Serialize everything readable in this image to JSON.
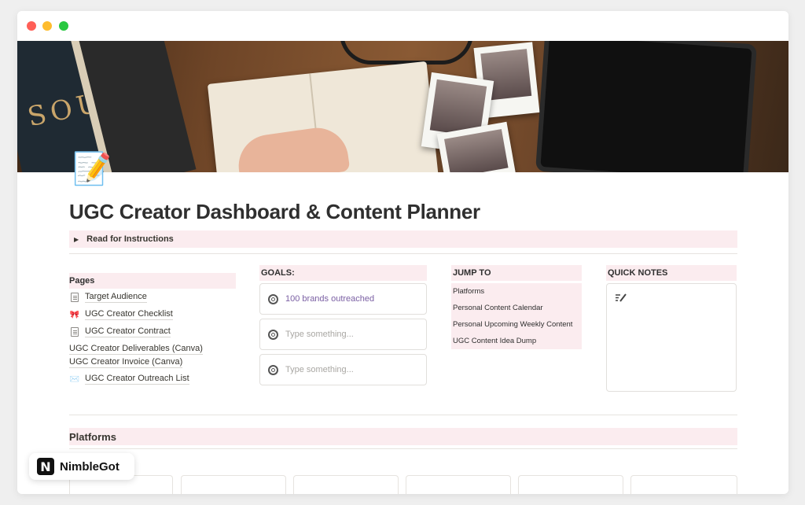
{
  "page": {
    "title": "UGC Creator Dashboard & Content Planner",
    "icon": "📝",
    "instructions_toggle": "Read for Instructions"
  },
  "pages_section": {
    "heading": "Pages",
    "items": [
      {
        "label": "Target Audience",
        "icon": "document-icon"
      },
      {
        "label": "UGC Creator Checklist",
        "icon": "ribbon-icon",
        "glyph": "🎀"
      },
      {
        "label": "UGC Creator Contract",
        "icon": "document-icon"
      },
      {
        "label": "UGC Creator Deliverables (Canva)",
        "icon": ""
      },
      {
        "label": "UGC Creator Invoice (Canva)",
        "icon": ""
      },
      {
        "label": "UGC Creator Outreach List",
        "icon": "envelope-icon",
        "glyph": "✉️"
      }
    ]
  },
  "goals": {
    "heading": "GOALS:",
    "items": [
      {
        "text": "100 brands outreached",
        "placeholder": false
      },
      {
        "text": "Type something...",
        "placeholder": true
      },
      {
        "text": "Type something...",
        "placeholder": true
      }
    ]
  },
  "jump_to": {
    "heading": "JUMP TO",
    "items": [
      "Platforms",
      "Personal Content Calendar",
      "Personal Upcoming Weekly Content",
      "UGC Content Idea Dump"
    ]
  },
  "quick_notes": {
    "heading": "QUICK NOTES",
    "icon": "pen-lines-icon"
  },
  "platforms": {
    "heading": "Platforms"
  },
  "brand": {
    "logo_letter": "N",
    "name": "NimbleGot"
  },
  "colors": {
    "highlight": "#fbecef",
    "link_purple": "#7a5fa3",
    "window_bg": "#ffffff",
    "outer_bg": "#efefef"
  }
}
